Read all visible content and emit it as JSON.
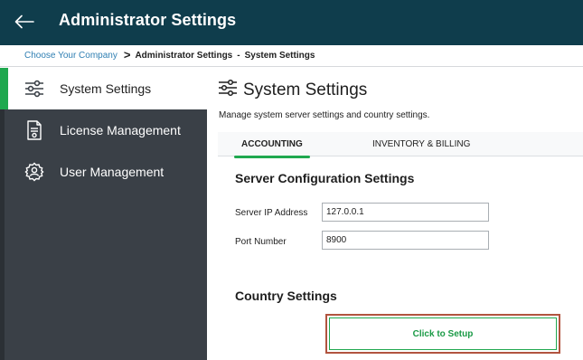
{
  "header": {
    "title": "Administrator Settings",
    "back_icon": "arrow-left-icon",
    "background": "#0f3d4c"
  },
  "breadcrumb": {
    "link": "Choose Your Company",
    "separator": ">",
    "current": "Administrator Settings",
    "dash": "-",
    "sub": "System Settings"
  },
  "sidebar": {
    "background": "#3a4047",
    "items": [
      {
        "label": "System Settings",
        "icon": "sliders-icon",
        "active": true
      },
      {
        "label": "License Management",
        "icon": "document-icon",
        "active": false
      },
      {
        "label": "User Management",
        "icon": "user-gear-icon",
        "active": false
      }
    ]
  },
  "main": {
    "title": "System Settings",
    "title_icon": "sliders-icon",
    "description": "Manage system server settings and country settings.",
    "tabs": [
      {
        "label": "ACCOUNTING",
        "active": true
      },
      {
        "label": "INVENTORY & BILLING",
        "active": false
      }
    ],
    "server_section": {
      "title": "Server Configuration Settings",
      "ip_label": "Server IP Address",
      "ip_value": "127.0.0.1",
      "port_label": "Port Number",
      "port_value": "8900"
    },
    "country_section": {
      "title": "Country Settings",
      "setup_button": "Click to Setup"
    }
  },
  "colors": {
    "accent_green": "#1fa84f",
    "highlight_border": "#b1543f",
    "link_blue": "#2f7fb3"
  }
}
